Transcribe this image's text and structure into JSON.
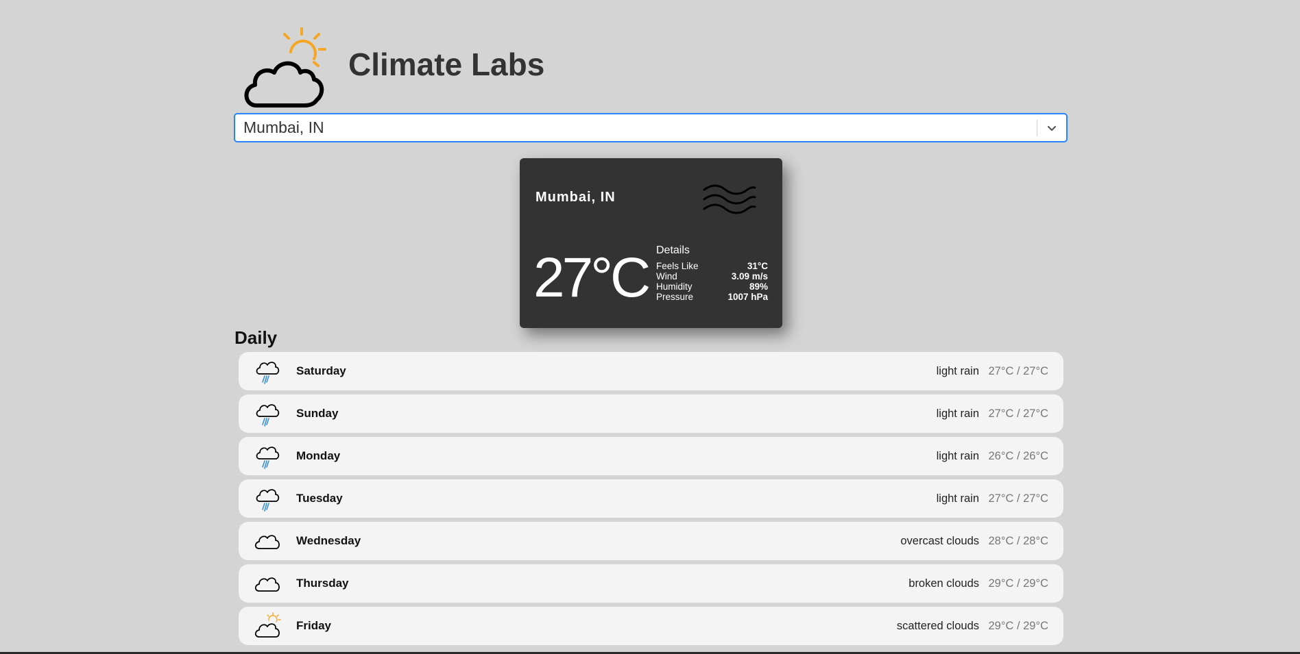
{
  "app": {
    "title": "Climate Labs",
    "logo_icon": "cloud-sun-icon"
  },
  "search": {
    "selected_value": "Mumbai, IN",
    "dropdown_icon": "chevron-down-icon",
    "border_color": "#2684ff"
  },
  "current": {
    "city": "Mumbai, IN",
    "condition_icon": "haze-wind-icon",
    "temperature": "27°C",
    "details_title": "Details",
    "details": [
      {
        "label": "Feels Like",
        "value": "31°C"
      },
      {
        "label": "Wind",
        "value": "3.09 m/s"
      },
      {
        "label": "Humidity",
        "value": "89%"
      },
      {
        "label": "Pressure",
        "value": "1007 hPa"
      }
    ]
  },
  "daily": {
    "title": "Daily",
    "days": [
      {
        "day": "Saturday",
        "description": "light rain",
        "temp": "27°C / 27°C",
        "icon": "rain-cloud-icon"
      },
      {
        "day": "Sunday",
        "description": "light rain",
        "temp": "27°C / 27°C",
        "icon": "rain-cloud-icon"
      },
      {
        "day": "Monday",
        "description": "light rain",
        "temp": "26°C / 26°C",
        "icon": "rain-cloud-icon"
      },
      {
        "day": "Tuesday",
        "description": "light rain",
        "temp": "27°C / 27°C",
        "icon": "rain-cloud-icon"
      },
      {
        "day": "Wednesday",
        "description": "overcast clouds",
        "temp": "28°C / 28°C",
        "icon": "cloud-icon"
      },
      {
        "day": "Thursday",
        "description": "broken clouds",
        "temp": "29°C / 29°C",
        "icon": "cloud-icon"
      },
      {
        "day": "Friday",
        "description": "scattered clouds",
        "temp": "29°C / 29°C",
        "icon": "cloud-sun-icon"
      }
    ]
  },
  "colors": {
    "background": "#d4d4d4",
    "card": "#333333",
    "row": "#f4f4f4",
    "sun": "#f5a623",
    "rain": "#3a8fd6"
  }
}
